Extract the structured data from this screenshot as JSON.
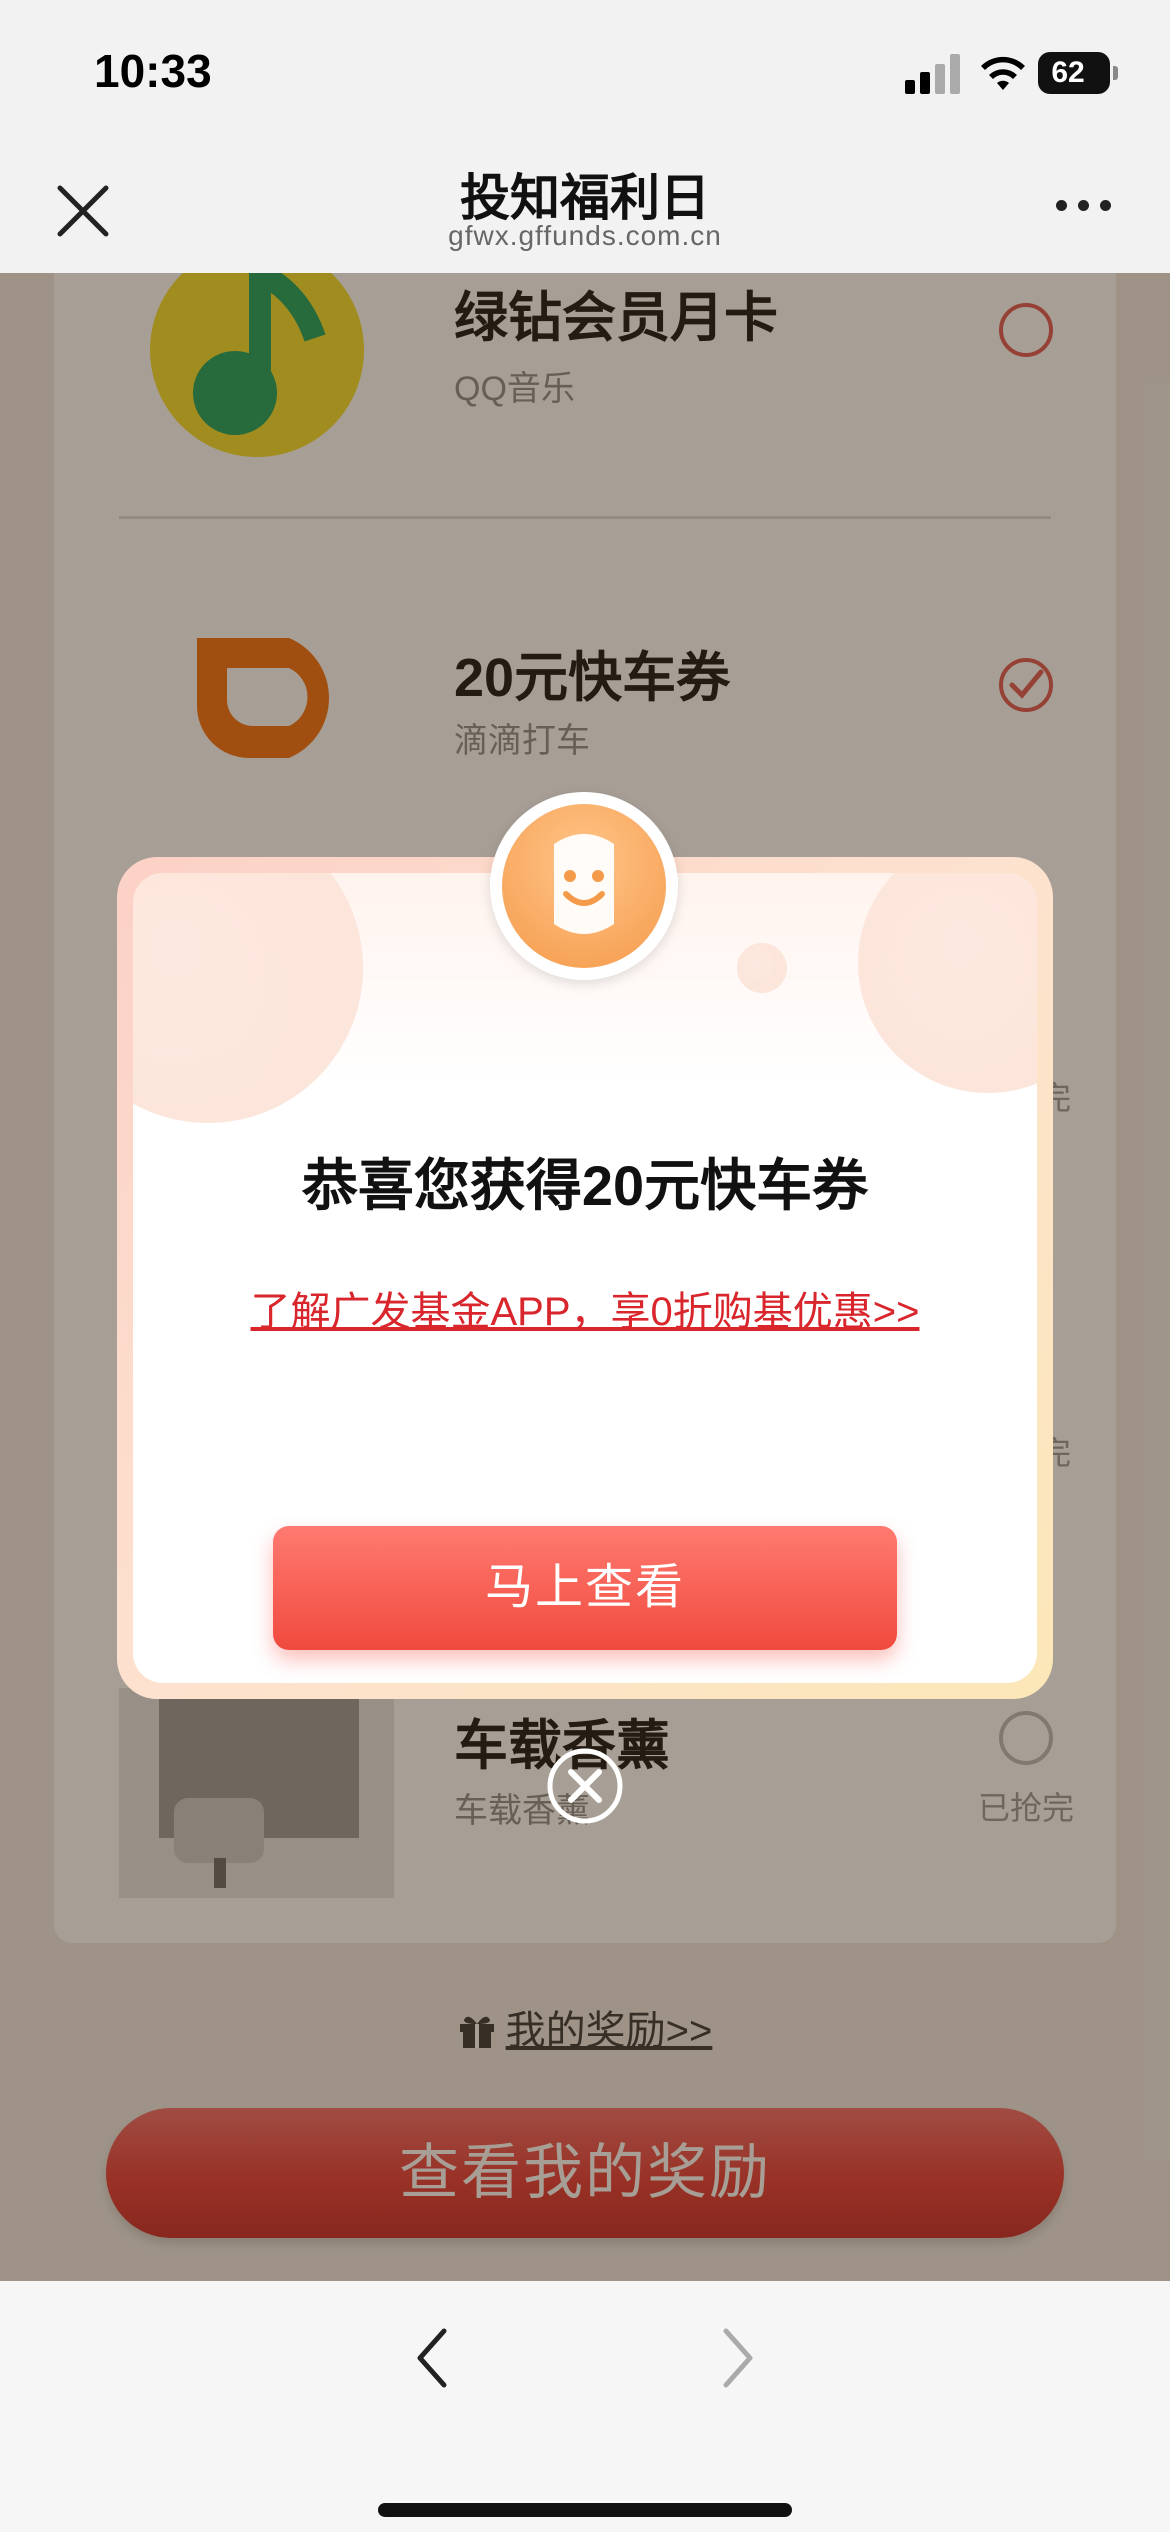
{
  "status_bar": {
    "time": "10:33",
    "battery": "62"
  },
  "header": {
    "title": "投知福利日",
    "url": "gfwx.gffunds.com.cn"
  },
  "rewards": [
    {
      "title": "绿钻会员月卡",
      "subtitle": "QQ音乐",
      "selected": false
    },
    {
      "title": "20元快车券",
      "subtitle": "滴滴打车",
      "selected": true
    },
    {
      "status": "完"
    },
    {
      "status": "完"
    },
    {
      "title": "车载香薰",
      "subtitle": "车载香薰",
      "status": "已抢完",
      "selected": false
    }
  ],
  "my_rewards_link": "我的奖励>>",
  "view_rewards_button": "查看我的奖励",
  "modal": {
    "title": "恭喜您获得20元快车券",
    "promo_link": "了解广发基金APP，享0折购基优惠>>",
    "view_button": "马上查看"
  },
  "colors": {
    "accent": "#f04a3e",
    "link": "#d8262c",
    "selected_radio": "#e05650"
  },
  "icons": {
    "close": "close-icon",
    "more": "more-icon",
    "back": "chevron-left-icon",
    "forward": "chevron-right-icon"
  }
}
